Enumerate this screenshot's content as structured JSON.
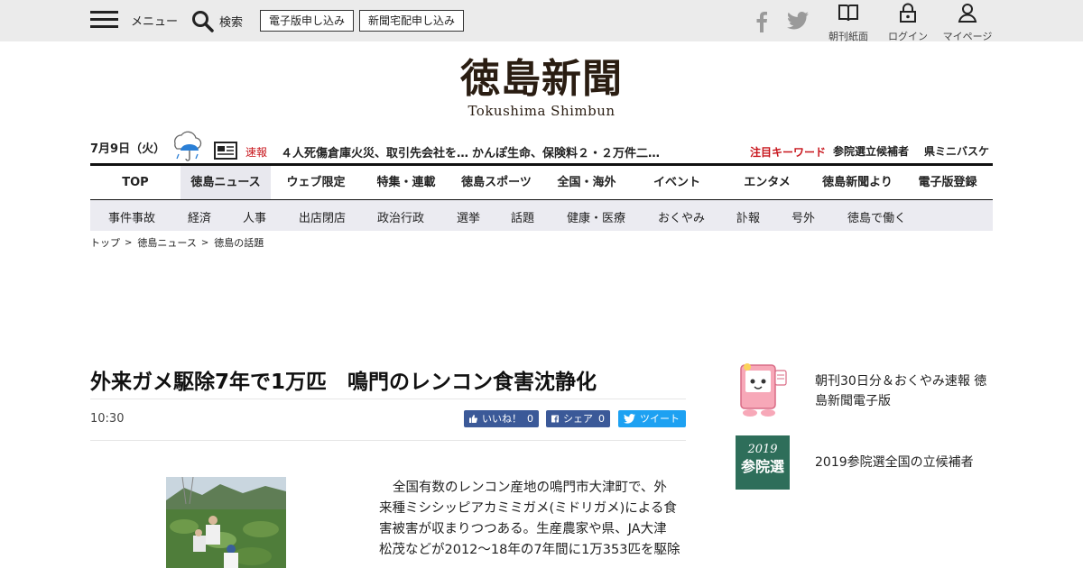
{
  "topbar": {
    "menu_label": "メニュー",
    "search_label": "検索",
    "buttons": [
      "電子版申し込み",
      "新聞宅配申し込み"
    ],
    "utility": [
      {
        "label": "朝刊紙面",
        "icon": "open-book-icon"
      },
      {
        "label": "ログイン",
        "icon": "lock-icon"
      },
      {
        "label": "マイページ",
        "icon": "user-icon"
      }
    ],
    "social_icons": [
      "facebook-icon",
      "twitter-icon"
    ]
  },
  "logo": {
    "kanji": "徳島新聞",
    "roman": "Tokushima Shimbun"
  },
  "infobar": {
    "date": "7月9日（火）",
    "weather_icon": "umbrella-rain-icon",
    "sokuhou_label": "速報",
    "ticker": [
      "４人死傷倉庫火災、取引先会社を…",
      "かんぽ生命、保険料２・２万件二…"
    ],
    "keyword_label": "注目キーワード",
    "keywords": [
      "参院選立候補者",
      "県ミニバスケ"
    ]
  },
  "mainnav": [
    "TOP",
    "徳島ニュース",
    "ウェブ限定",
    "特集・連載",
    "徳島スポーツ",
    "全国・海外",
    "イベント",
    "エンタメ",
    "徳島新聞より",
    "電子版登録"
  ],
  "subnav": [
    "事件事故",
    "経済",
    "人事",
    "出店閉店",
    "政治行政",
    "選挙",
    "話題",
    "健康・医療",
    "おくやみ",
    "訃報",
    "号外",
    "徳島で働く"
  ],
  "breadcrumb": [
    "トップ",
    "徳島ニュース",
    "徳島の話題"
  ],
  "article": {
    "headline": "外来ガメ駆除7年で1万匹　鳴門のレンコン食害沈静化",
    "time": "10:30",
    "like_label": "いいね！",
    "like_count": "0",
    "share_label": "シェア",
    "share_count": "0",
    "tweet_label": "ツイート",
    "body_lines": [
      "全国有数のレンコン産地の鳴門市大津町で、外",
      "来種ミシシッピアカミミガメ(ミドリガメ)による食",
      "害被害が収まりつつある。生産農家や県、JA大津",
      "松茂などが2012～18年の7年間に1万353匹を駆除"
    ]
  },
  "sidebar": [
    {
      "text": "朝刊30日分＆おくやみ速報 徳島新聞電子版",
      "thumb": "mascot-tablet-icon"
    },
    {
      "text": "2019参院選全国の立候補者",
      "thumb_year": "2019",
      "thumb_name": "参院選"
    }
  ],
  "colors": {
    "topbar_bg": "#ebebeb",
    "accent_red": "#c8161d",
    "facebook": "#3b5998",
    "twitter": "#1da1f2",
    "subnav_bg": "#ebebf1",
    "active_tab": "#e8e8ee"
  }
}
